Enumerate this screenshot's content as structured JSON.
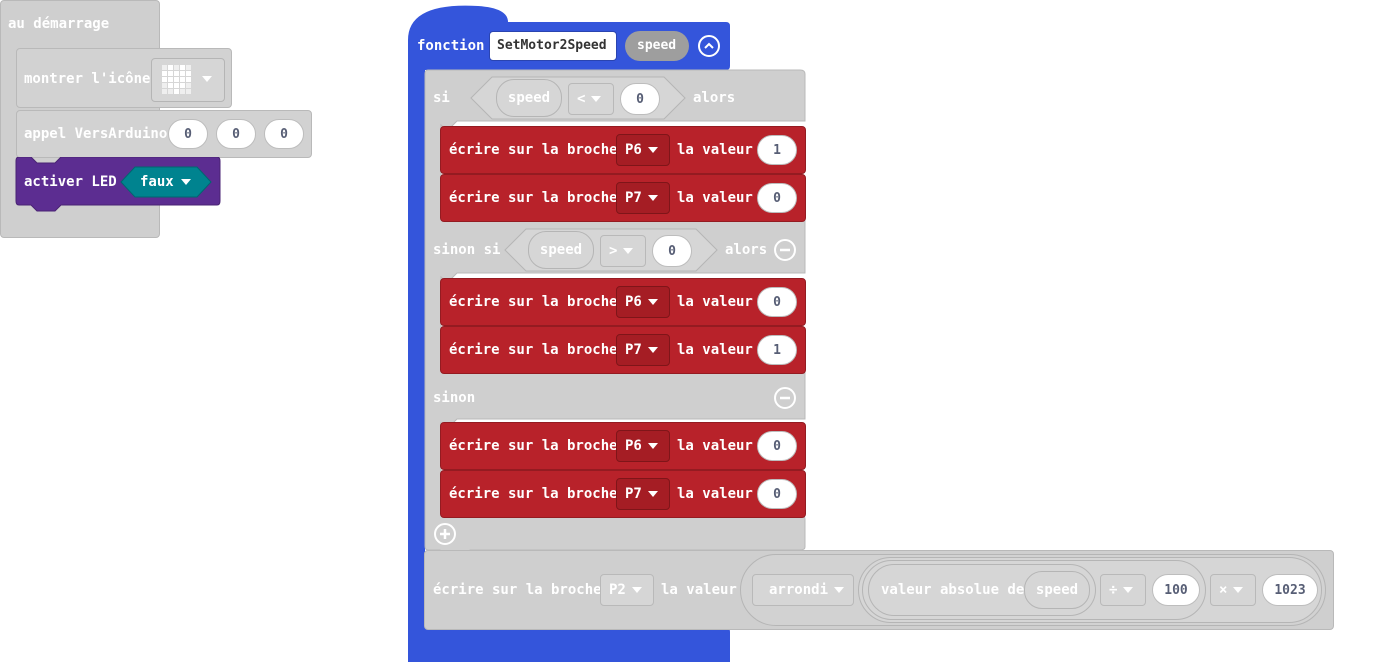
{
  "startup": {
    "hat_label": "au démarrage",
    "show_icon_label": "montrer l'icône",
    "call_label": "appel VersArduino",
    "call_args": [
      "0",
      "0",
      "0"
    ],
    "led_label": "activer LED",
    "led_value": "faux"
  },
  "function": {
    "keyword": "fonction",
    "name": "SetMotor2Speed",
    "param": "speed",
    "if_label": "si",
    "then_label": "alors",
    "else_if_label": "sinon si",
    "else_label": "sinon",
    "cond1": {
      "var": "speed",
      "op": "<",
      "value": "0"
    },
    "cond2": {
      "var": "speed",
      "op": ">",
      "value": "0"
    },
    "write_label": "écrire sur la broche",
    "value_label": "la valeur",
    "branch1": [
      {
        "pin": "P6",
        "value": "1"
      },
      {
        "pin": "P7",
        "value": "0"
      }
    ],
    "branch2": [
      {
        "pin": "P6",
        "value": "0"
      },
      {
        "pin": "P7",
        "value": "1"
      }
    ],
    "branch3": [
      {
        "pin": "P6",
        "value": "0"
      },
      {
        "pin": "P7",
        "value": "0"
      }
    ],
    "analog": {
      "pin": "P2",
      "round_label": "arrondi",
      "abs_label": "valeur absolue de",
      "var": "speed",
      "div_op": "÷",
      "divisor": "100",
      "mul_op": "×",
      "multiplier": "1023"
    }
  },
  "colors": {
    "function_blue": "#3455db",
    "pins_red": "#b8222a",
    "led_purple": "#5c2d91",
    "logic_teal": "#00838f",
    "disabled_gray": "#cfcfcf"
  }
}
